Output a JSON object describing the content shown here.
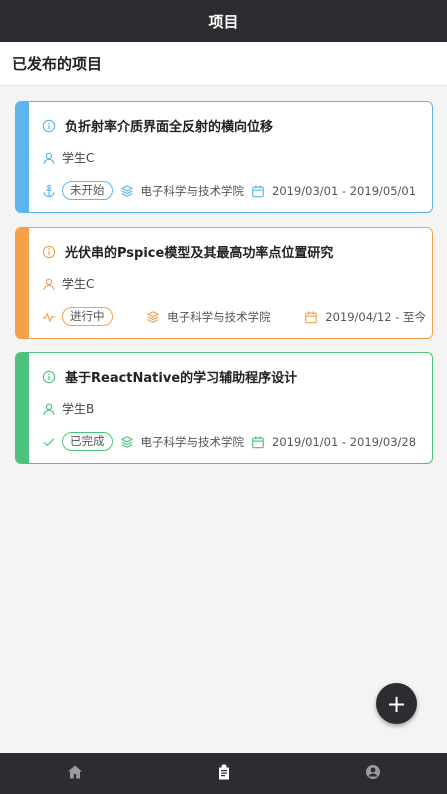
{
  "header": {
    "title": "项目"
  },
  "section": {
    "title": "已发布的项目"
  },
  "projects": [
    {
      "title": "负折射率介质界面全反射的横向位移",
      "student": "学生C",
      "status": "未开始",
      "department": "电子科学与技术学院",
      "date_range": "2019/03/01 - 2019/05/01",
      "color": "#5ab6ec",
      "status_icon": "anchor-icon"
    },
    {
      "title": "光伏串的Pspice模型及其最高功率点位置研究",
      "student": "学生C",
      "status": "进行中",
      "department": "电子科学与技术学院",
      "date_range": "2019/04/12 - 至今",
      "color": "#f6a04a",
      "status_icon": "activity-icon"
    },
    {
      "title": "基于ReactNative的学习辅助程序设计",
      "student": "学生B",
      "status": "已完成",
      "department": "电子科学与技术学院",
      "date_range": "2019/01/01 - 2019/03/28",
      "color": "#4cc27e",
      "status_icon": "check-icon"
    }
  ],
  "fab": {
    "label": "+"
  },
  "tabs": [
    {
      "icon": "home-icon",
      "active": false
    },
    {
      "icon": "clipboard-icon",
      "active": true
    },
    {
      "icon": "account-icon",
      "active": false
    }
  ],
  "colors": {
    "bar": "#2c2d30",
    "inactive_tab": "#9a9a9a",
    "active_tab": "#ffffff"
  }
}
